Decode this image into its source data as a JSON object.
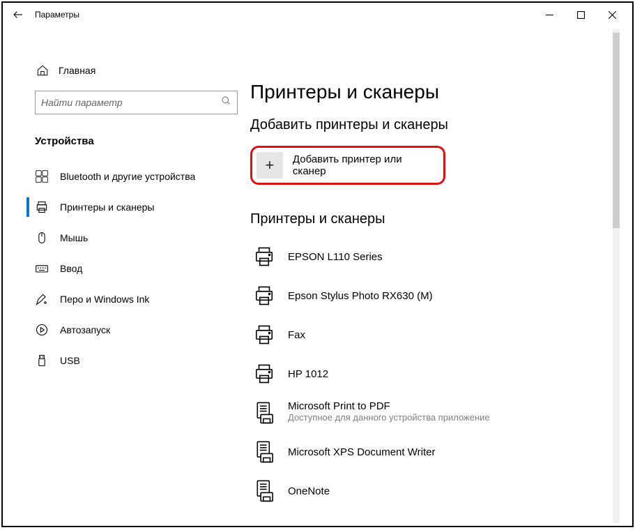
{
  "window": {
    "title": "Параметры"
  },
  "sidebar": {
    "home_label": "Главная",
    "search_placeholder": "Найти параметр",
    "section_label": "Устройства",
    "items": [
      {
        "label": "Bluetooth и другие устройства"
      },
      {
        "label": "Принтеры и сканеры"
      },
      {
        "label": "Мышь"
      },
      {
        "label": "Ввод"
      },
      {
        "label": "Перо и Windows Ink"
      },
      {
        "label": "Автозапуск"
      },
      {
        "label": "USB"
      }
    ],
    "active_index": 1
  },
  "main": {
    "page_title": "Принтеры и сканеры",
    "add_section_header": "Добавить принтеры и сканеры",
    "add_button_label": "Добавить принтер или сканер",
    "list_section_header": "Принтеры и сканеры",
    "devices": [
      {
        "name": "EPSON L110 Series",
        "sub": "",
        "icon": "printer"
      },
      {
        "name": "Epson Stylus Photo RX630 (M)",
        "sub": "",
        "icon": "printer"
      },
      {
        "name": "Fax",
        "sub": "",
        "icon": "printer"
      },
      {
        "name": "HP 1012",
        "sub": "",
        "icon": "printer"
      },
      {
        "name": "Microsoft Print to PDF",
        "sub": "Доступное для данного устройства приложение",
        "icon": "document-printer"
      },
      {
        "name": "Microsoft XPS Document Writer",
        "sub": "",
        "icon": "document-printer"
      },
      {
        "name": "OneNote",
        "sub": "",
        "icon": "document-printer"
      }
    ]
  }
}
